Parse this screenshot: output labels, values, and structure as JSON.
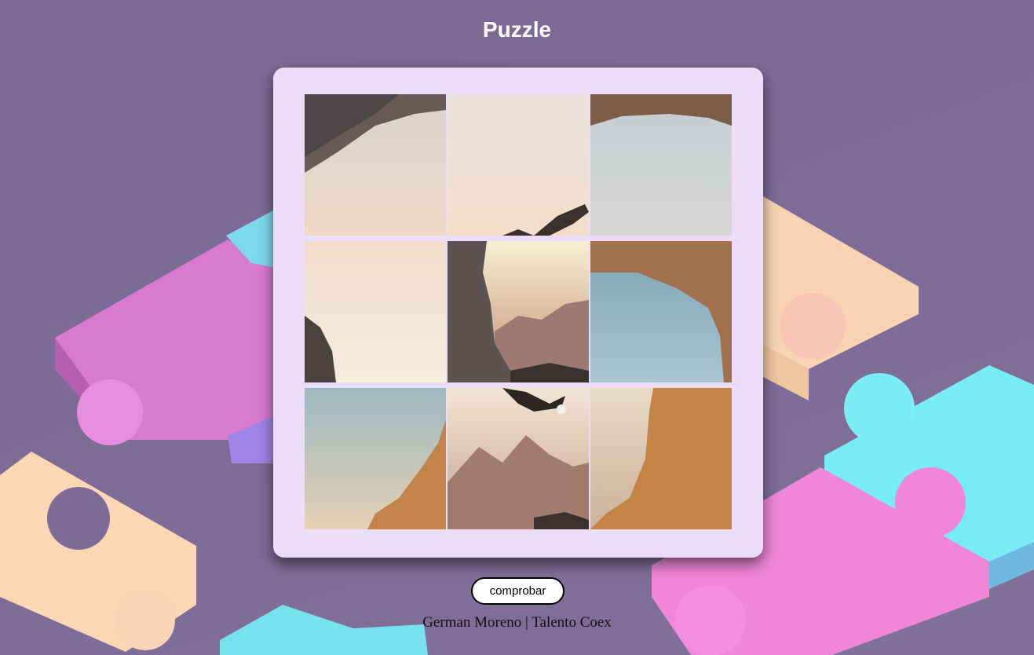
{
  "header": {
    "title": "Puzzle"
  },
  "actions": {
    "check_label": "comprobar"
  },
  "footer": {
    "credit": "German Moreno | Talento Coex"
  },
  "colors": {
    "background": "#7d6b96",
    "board": "#ecdcf8",
    "piece_pink": "#e07ed3",
    "piece_peach": "#fcd8b4",
    "piece_cyan": "#74e6f2"
  },
  "puzzle": {
    "grid": "3x3",
    "tiles": [
      {
        "name": "tile-1",
        "content": "cave-rock-top-left"
      },
      {
        "name": "tile-2",
        "content": "sky-eagle-wing"
      },
      {
        "name": "tile-3",
        "content": "cave-rock-top-right"
      },
      {
        "name": "tile-4",
        "content": "sky-rock-left"
      },
      {
        "name": "tile-5",
        "content": "cliff-mountains-sunset"
      },
      {
        "name": "tile-6",
        "content": "cave-arch-right"
      },
      {
        "name": "tile-7",
        "content": "cliff-bottom-left"
      },
      {
        "name": "tile-8",
        "content": "eagle-mountains"
      },
      {
        "name": "tile-9",
        "content": "cliff-bottom-right"
      }
    ]
  }
}
